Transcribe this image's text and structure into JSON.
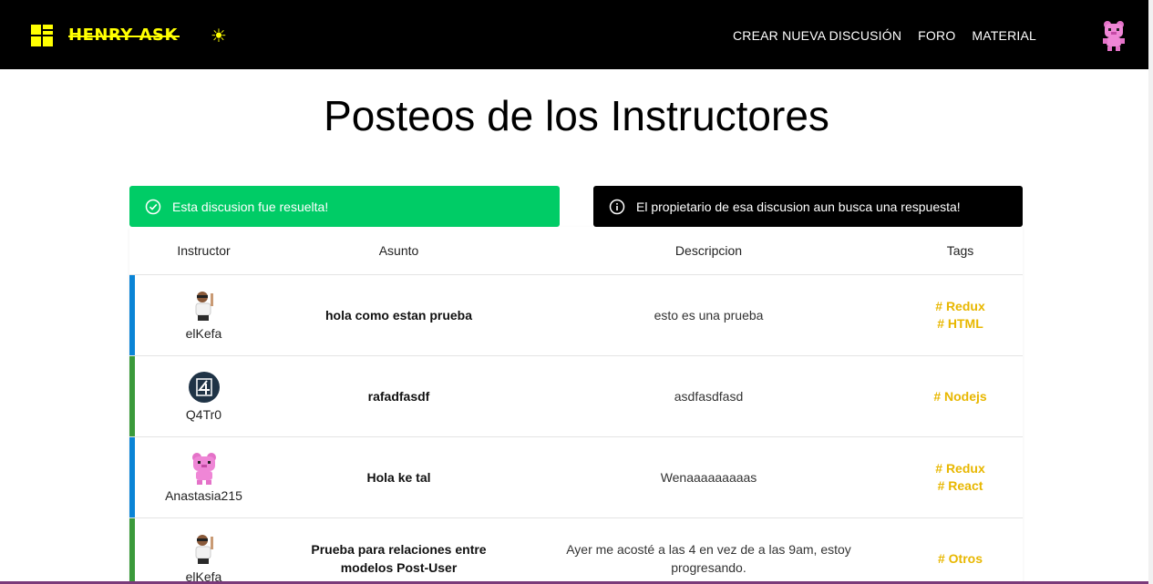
{
  "header": {
    "brand": "HENRY ASK",
    "nav": [
      "CREAR NUEVA DISCUSIÓN",
      "FORO",
      "MATERIAL"
    ],
    "icons": {
      "logo": "henry-logo-icon",
      "theme": "sun-icon",
      "avatar": "pink-bear-avatar"
    }
  },
  "page": {
    "title_prefix": "Posteos de los",
    "title_highlight": "Instructores"
  },
  "banners": {
    "resolved": "Esta discusion fue resuelta!",
    "pending": "El propietario de esa discusion aun busca una respuesta!"
  },
  "table": {
    "headers": [
      "Instructor",
      "Asunto",
      "Descripcion",
      "Tags"
    ],
    "rows": [
      {
        "instructor": "elKefa",
        "avatar": "man-waving-avatar",
        "subject": "hola como estan prueba",
        "description": "esto es una prueba",
        "tags": [
          "# Redux",
          "# HTML"
        ],
        "status": "pending",
        "bar_color": "#0a84d6"
      },
      {
        "instructor": "Q4Tr0",
        "avatar": "number-four-avatar",
        "subject": "rafadfasdf",
        "description": "asdfasdfasd",
        "tags": [
          "# Nodejs"
        ],
        "status": "resolved",
        "bar_color": "#3a9a3a"
      },
      {
        "instructor": "Anastasia215",
        "avatar": "pink-bear-avatar",
        "subject": "Hola ke tal",
        "description": "Wenaaaaaaaaas",
        "tags": [
          "# Redux",
          "# React"
        ],
        "status": "pending",
        "bar_color": "#0a84d6"
      },
      {
        "instructor": "elKefa",
        "avatar": "man-waving-avatar",
        "subject": "Prueba para relaciones entre modelos Post-User",
        "description": "Ayer me acosté a las 4 en vez de a las 9am, estoy progresando.",
        "tags": [
          "# Otros"
        ],
        "status": "resolved",
        "bar_color": "#3a9a3a"
      }
    ]
  },
  "colors": {
    "accent": "#ffff01",
    "tag": "#e8b700",
    "resolved": "#00cc66",
    "pending": "#000000"
  }
}
